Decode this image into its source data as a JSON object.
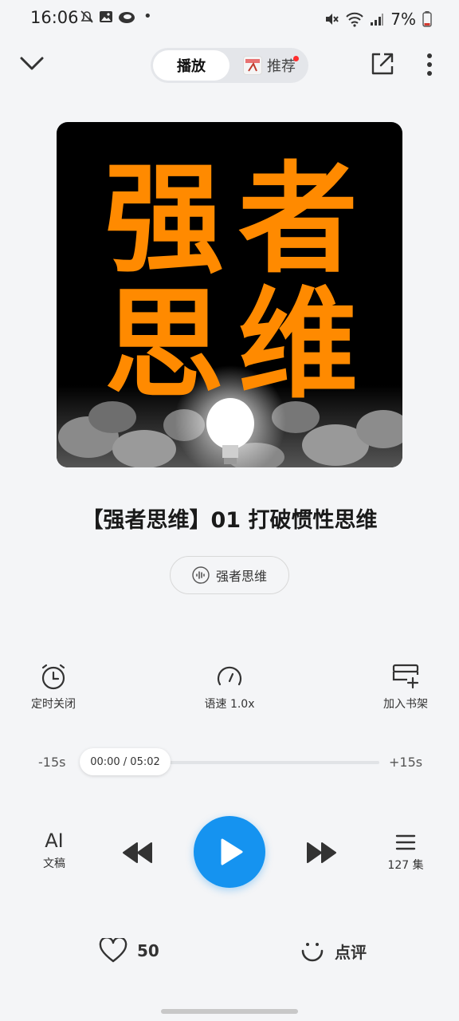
{
  "status_bar": {
    "time": "16:06",
    "battery": "7%",
    "dot": "•"
  },
  "top_bar": {
    "tab_play": "播放",
    "tab_recommend": "推荐",
    "accent_color": "#1593f0",
    "badge_color": "#ff2d2d"
  },
  "cover": {
    "line1": "强者",
    "line2": "思维",
    "char1": "强",
    "char2": "者",
    "char3": "思",
    "char4": "维",
    "text_color": "#ff8a00"
  },
  "track": {
    "title": "【强者思维】01 打破惯性思维",
    "album": "强者思维"
  },
  "tools": {
    "timer_label": "定时关闭",
    "speed_label": "语速 1.0x",
    "shelf_label": "加入书架"
  },
  "progress": {
    "rewind_label": "-15s",
    "forward_label": "+15s",
    "time_display": "00:00 / 05:02",
    "fraction": 0
  },
  "controls": {
    "ai_label": "AI",
    "ai_sub_label": "文稿",
    "episodes_label": "127 集"
  },
  "bottom": {
    "like_count": "50",
    "comment_label": "点评"
  }
}
